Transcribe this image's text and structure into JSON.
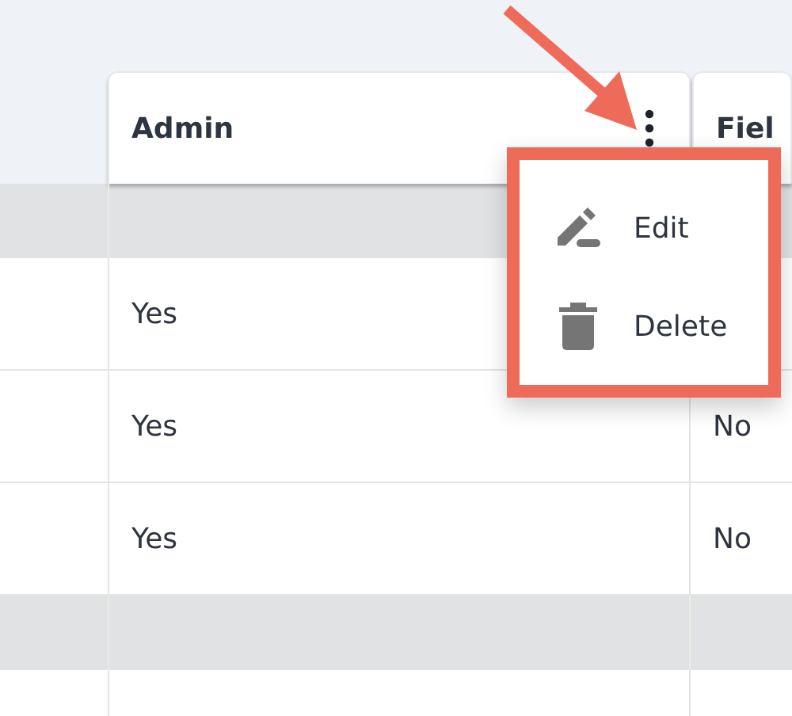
{
  "table": {
    "columns": [
      {
        "label": "Admin",
        "menu_button": true
      },
      {
        "label": "Fiel",
        "menu_button": false
      }
    ],
    "rows": [
      {
        "kind": "group"
      },
      {
        "kind": "data",
        "admin": "Yes"
      },
      {
        "kind": "data",
        "admin": "Yes",
        "field": "No"
      },
      {
        "kind": "data",
        "admin": "Yes",
        "field": "No"
      },
      {
        "kind": "group"
      },
      {
        "kind": "data"
      }
    ]
  },
  "column_menu": {
    "highlighted": true,
    "annotation_arrow": true,
    "items": [
      {
        "label": "Edit",
        "kind": "pencil"
      },
      {
        "label": "Delete",
        "kind": "trash"
      }
    ]
  }
}
